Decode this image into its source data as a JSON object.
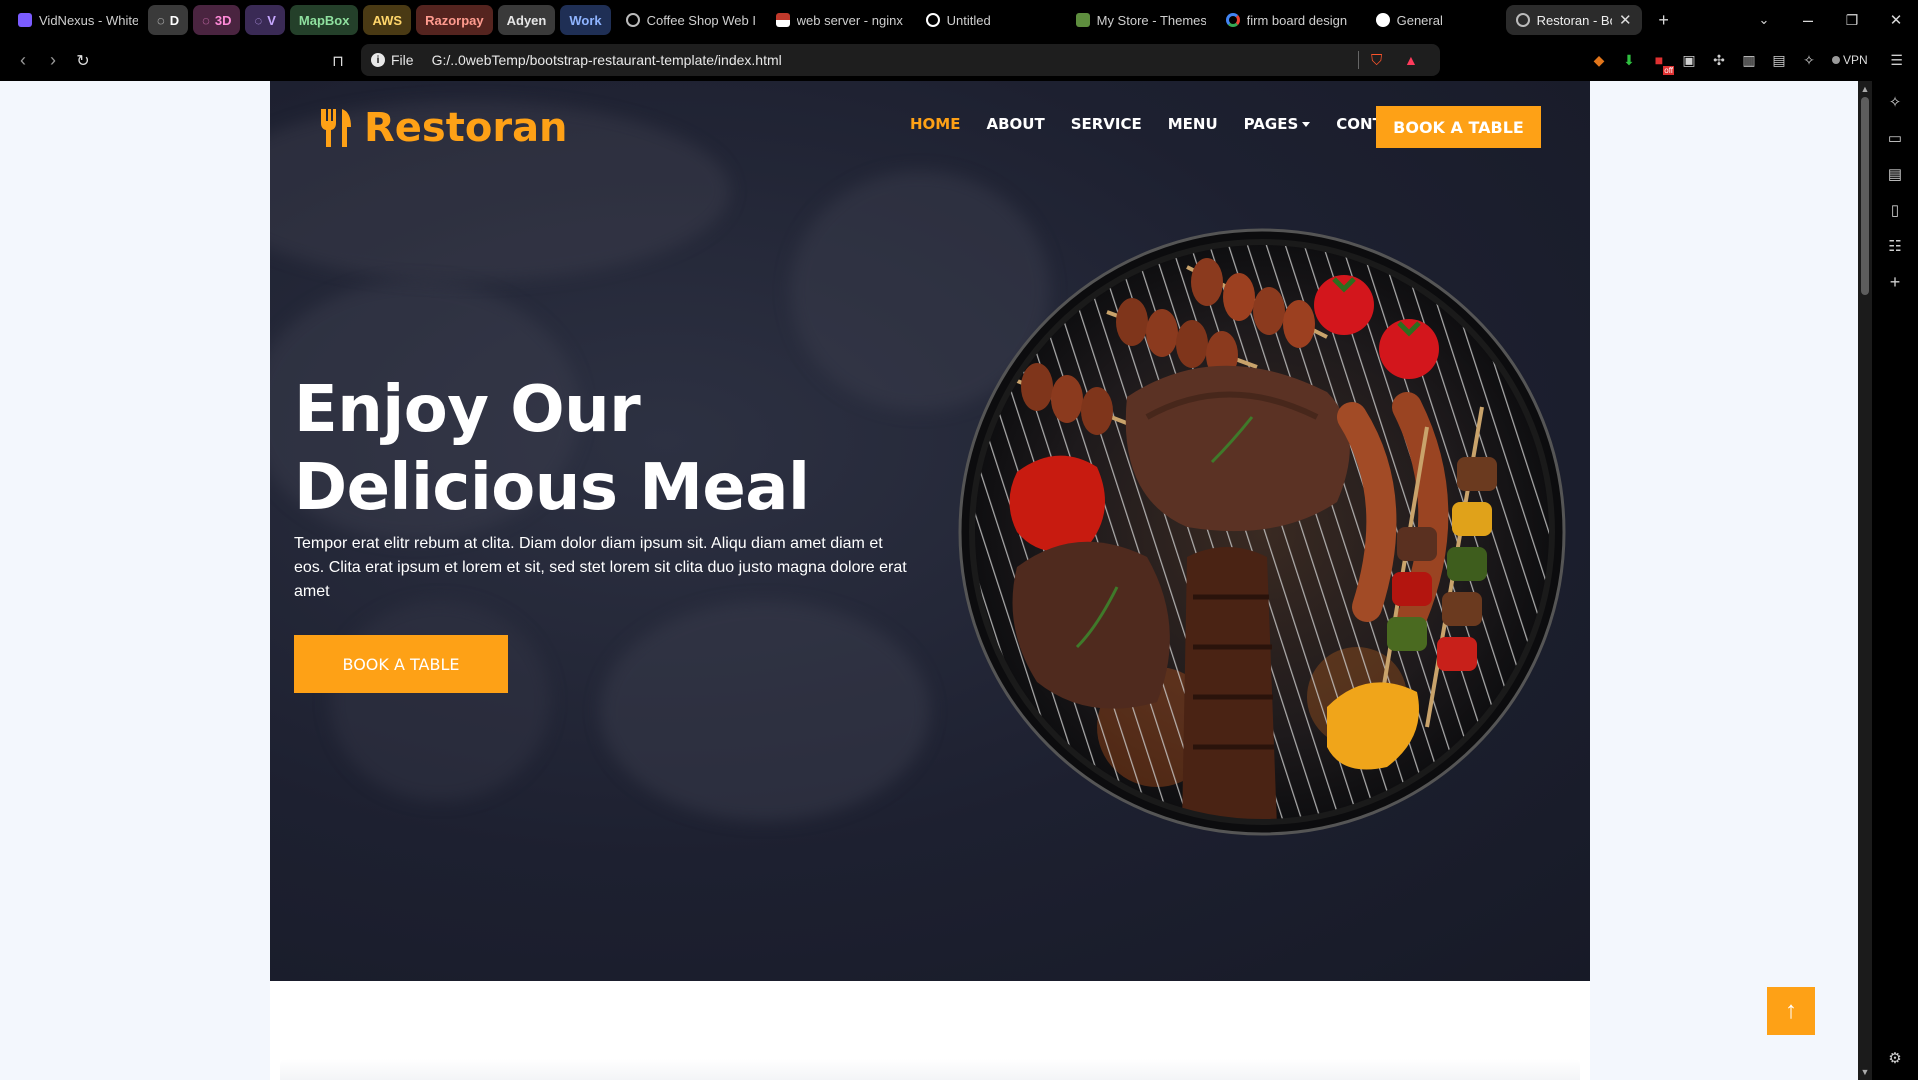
{
  "browser": {
    "tabs": [
      {
        "label": "VidNexus - Whiteb",
        "color": "#7b5cff"
      },
      {
        "group": "D",
        "bg": "#3a3a3a",
        "fg": "#ffffff"
      },
      {
        "group": "3D",
        "bg": "#4a2440",
        "fg": "#ff8ad8"
      },
      {
        "group": "V",
        "bg": "#3a2a55",
        "fg": "#c7a8ff"
      },
      {
        "group": "MapBox",
        "bg": "#24402a",
        "fg": "#8fe09f"
      },
      {
        "group": "AWS",
        "bg": "#4a3a14",
        "fg": "#ffd66b"
      },
      {
        "group": "Razorpay",
        "bg": "#55241f",
        "fg": "#ff9b8f"
      },
      {
        "group": "Adyen",
        "bg": "#3a3a3a",
        "fg": "#e6e6e6"
      },
      {
        "group": "Work",
        "bg": "#1f2f55",
        "fg": "#8fb4ff"
      },
      {
        "label": "Coffee Shop Web I",
        "color": "#bbbbbb"
      },
      {
        "label": "web server - nginx",
        "color": "#c0392b"
      },
      {
        "label": "Untitled",
        "color": "#ffffff"
      },
      {
        "label": "My Store - Themes",
        "color": "#5e8e3e"
      },
      {
        "label": "firm board design",
        "color": "#4285f4"
      },
      {
        "label": "General",
        "color": "#ffffff"
      }
    ],
    "active_tab": "Restoran - Boo",
    "url_scheme": "File",
    "url": "G:/..0webTemp/bootstrap-restaurant-template/index.html",
    "vpn_label": "VPN",
    "ext_badge": "off"
  },
  "site": {
    "brand": "Restoran",
    "nav": [
      "HOME",
      "ABOUT",
      "SERVICE",
      "MENU",
      "PAGES",
      "CONTACT"
    ],
    "cta_top": "BOOK A TABLE",
    "hero_title_line1": "Enjoy Our",
    "hero_title_line2": "Delicious Meal",
    "hero_text": "Tempor erat elitr rebum at clita. Diam dolor diam ipsum sit. Aliqu diam amet diam et eos. Clita erat ipsum et lorem et sit, sed stet lorem sit clita duo justo magna dolore erat amet",
    "hero_cta": "BOOK A TABLE"
  },
  "colors": {
    "accent": "#FEA116",
    "hero_bg": "#1d2030"
  },
  "icons": {
    "back_to_top": "arrow-up-icon",
    "brand": "utensils-icon"
  }
}
